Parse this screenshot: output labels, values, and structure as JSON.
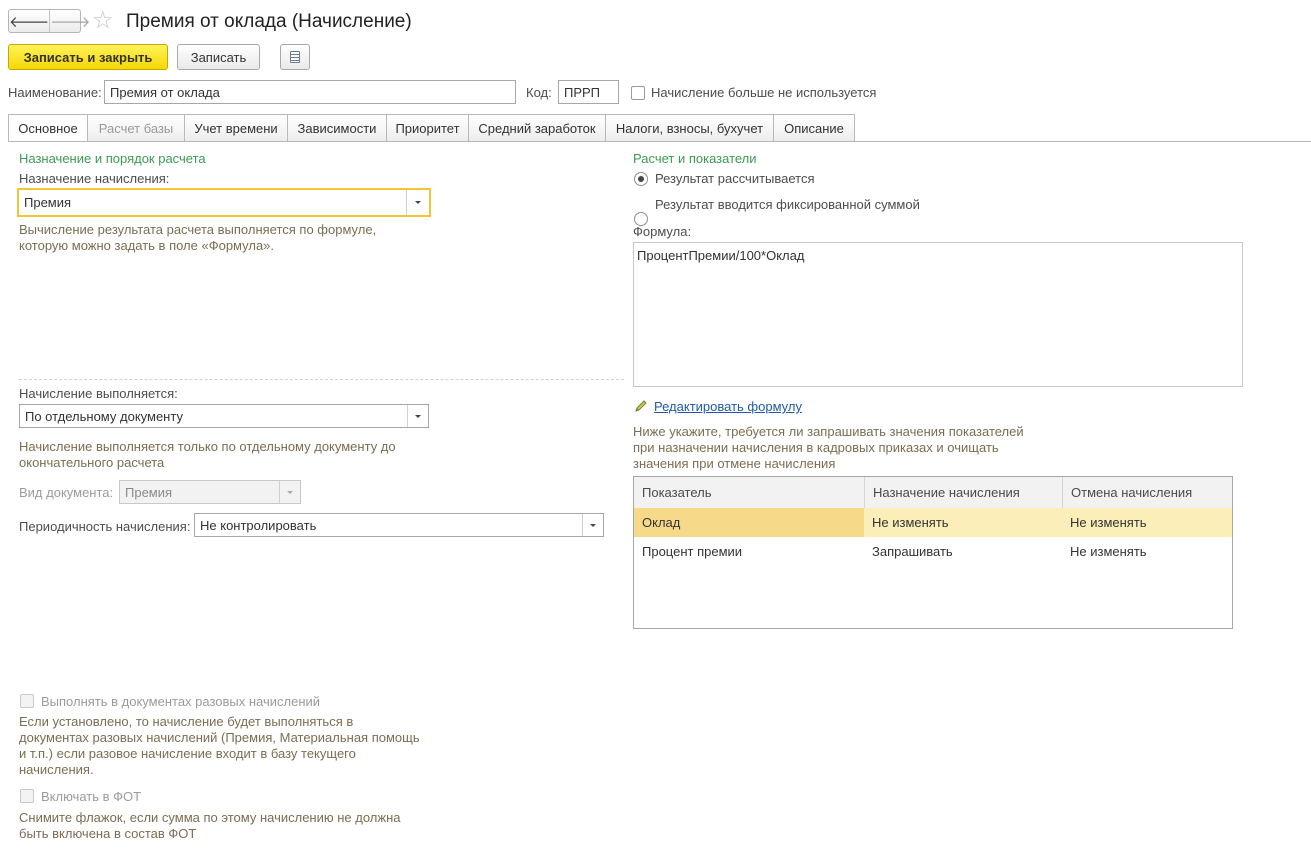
{
  "window": {
    "title": "Премия от оклада (Начисление)"
  },
  "nav": {
    "back": "🡐",
    "forward": "🡒",
    "favorite": "☆"
  },
  "toolbar": {
    "save_close_label": "Записать и закрыть",
    "save_label": "Записать",
    "report_icon": "list-document-icon"
  },
  "header": {
    "name_label": "Наименование:",
    "name_value": "Премия от оклада",
    "code_label": "Код:",
    "code_value": "ПРРП",
    "not_used_label": "Начисление больше не используется"
  },
  "tabs": [
    {
      "label": "Основное"
    },
    {
      "label": "Расчет базы"
    },
    {
      "label": "Учет времени"
    },
    {
      "label": "Зависимости"
    },
    {
      "label": "Приоритет"
    },
    {
      "label": "Средний заработок"
    },
    {
      "label": "Налоги, взносы, бухучет"
    },
    {
      "label": "Описание"
    }
  ],
  "left": {
    "section_title": "Назначение и порядок расчета",
    "purpose_label": "Назначение начисления:",
    "purpose_value": "Премия",
    "purpose_hint": "Вычисление результата расчета выполняется по формуле, которую можно задать в поле «Формула».",
    "execution_label": "Начисление выполняется:",
    "execution_value": "По отдельному документу",
    "execution_hint": "Начисление выполняется только по отдельному документу до окончательного расчета",
    "doctype_label": "Вид документа:",
    "doctype_value": "Премия",
    "periodicity_label": "Периодичность начисления:",
    "periodicity_value": "Не контролировать",
    "one_time_label": "Выполнять в документах разовых начислений",
    "one_time_hint": "Если установлено, то начисление будет выполняться в документах разовых начислений (Премия, Материальная помощь и т.п.) если разовое начисление входит в базу текущего начисления.",
    "fot_label": "Включать в ФОТ",
    "fot_hint": "Снимите флажок, если сумма по этому начислению не должна быть включена в состав ФОТ"
  },
  "right": {
    "section_title": "Расчет и показатели",
    "radio_calculated": "Результат рассчитывается",
    "radio_fixed": "Результат вводится фиксированной суммой",
    "formula_label": "Формула:",
    "formula_value": "ПроцентПремии/100*Оклад",
    "edit_formula_link": "Редактировать формулу",
    "indicators_hint": "Ниже укажите, требуется ли запрашивать значения показателей при назначении начисления в кадровых приказах и очищать значения при отмене начисления",
    "table": {
      "columns": [
        "Показатель",
        "Назначение начисления",
        "Отмена начисления"
      ],
      "rows": [
        [
          "Оклад",
          "Не изменять",
          "Не изменять"
        ],
        [
          "Процент премии",
          "Запрашивать",
          "Не изменять"
        ]
      ]
    }
  }
}
